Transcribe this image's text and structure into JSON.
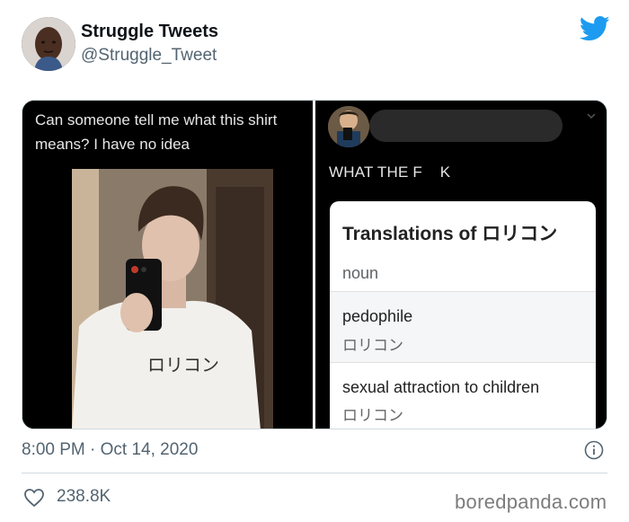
{
  "tweet": {
    "display_name": "Struggle Tweets",
    "handle": "@Struggle_Tweet",
    "timestamp": "8:00 PM · Oct 14, 2020",
    "like_count": "238.8K"
  },
  "media": {
    "left_caption": "Can someone tell me what this shirt means? I have no idea",
    "shirt_text": "ロリコン",
    "reply_text": "WHAT THE F    K",
    "translation": {
      "title": "Translations of ロリコン",
      "part_of_speech": "noun",
      "entries": [
        {
          "term": "pedophile",
          "source": "ロリコン"
        },
        {
          "term": "sexual attraction to children",
          "source": "ロリコン"
        }
      ]
    }
  },
  "watermark": "boredpanda.com",
  "colors": {
    "twitter_blue": "#1d9bf0",
    "secondary_text": "#536471",
    "border": "#cfd9de"
  },
  "icons": [
    "twitter-logo-icon",
    "info-icon",
    "heart-icon",
    "chevron-down-icon"
  ]
}
